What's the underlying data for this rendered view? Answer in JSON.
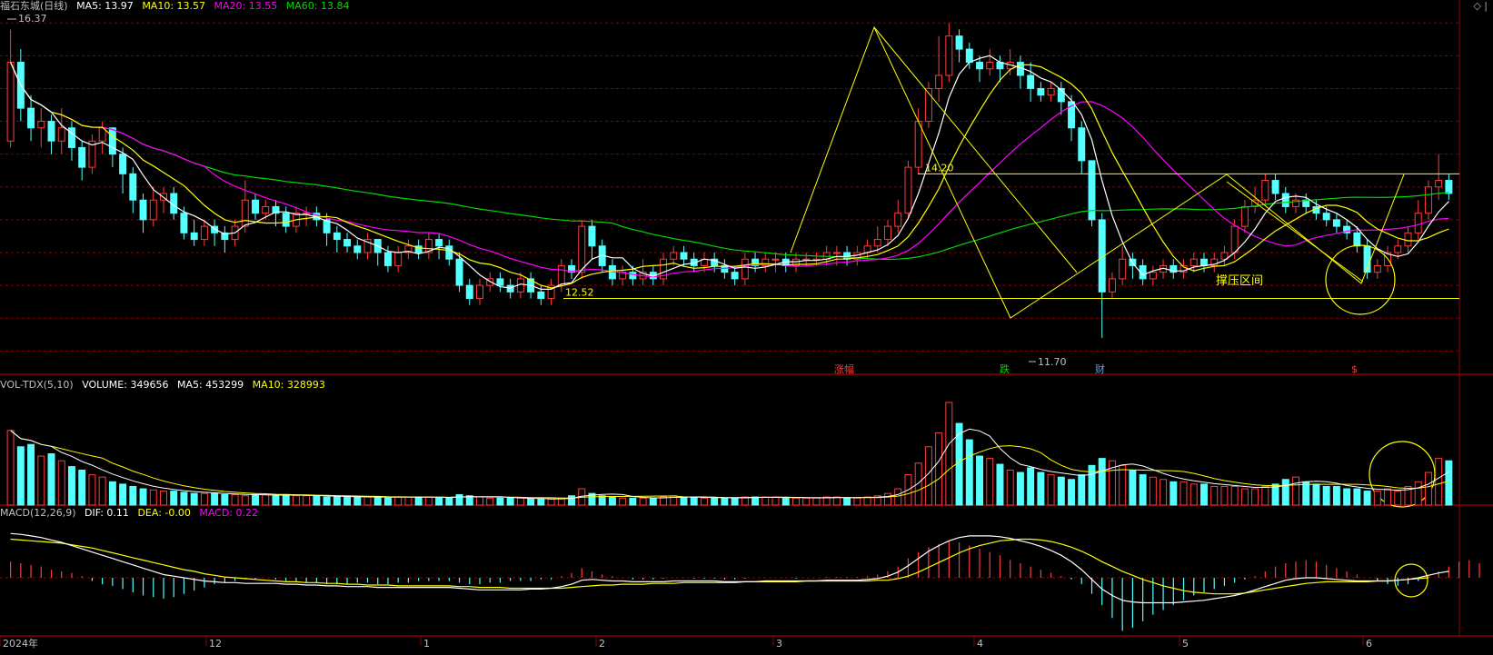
{
  "price_header": {
    "stock": "福石东城(日线)",
    "ma5": "MA5: 13.97",
    "ma10": "MA10: 13.57",
    "ma20": "MA20: 13.55",
    "ma60": "MA60: 13.84"
  },
  "vol_header": {
    "name": "VOL-TDX(5,10)",
    "volume": "VOLUME: 349656",
    "ma5": "MA5: 453299",
    "ma10": "MA10: 328993"
  },
  "macd_header": {
    "name": "MACD(12,26,9)",
    "dif": "DIF: 0.11",
    "dea": "DEA: -0.00",
    "macd": "MACD: 0.22"
  },
  "colors": {
    "up": "#ff3c3c",
    "down": "#54ffff",
    "ma5": "#ffffff",
    "ma10": "#ffff00",
    "ma20": "#ff00ff",
    "ma60": "#00d800",
    "grid": "#8a0000",
    "annot": "#ffff00"
  },
  "chart_data": {
    "type": "candlestick",
    "x_axis_labels": [
      "2024年",
      "12",
      "1",
      "2",
      "3",
      "4",
      "5",
      "6"
    ],
    "price_ylim": [
      11.2,
      16.6
    ],
    "annotations": {
      "high_label": "16.37",
      "low_label": "11.70",
      "level_high": "14.20",
      "level_low": "12.52",
      "zone_text": "撑压区间",
      "events": [
        "涨幅",
        "跌",
        "财",
        "$"
      ]
    },
    "candles": [
      [
        14.7,
        15.9,
        14.6,
        16.4
      ],
      [
        15.9,
        15.2,
        15.0,
        16.1
      ],
      [
        15.2,
        14.9,
        14.7,
        15.4
      ],
      [
        14.9,
        15.0,
        14.6,
        15.2
      ],
      [
        15.0,
        14.7,
        14.5,
        15.1
      ],
      [
        14.7,
        14.9,
        14.5,
        15.2
      ],
      [
        14.9,
        14.6,
        14.4,
        15.0
      ],
      [
        14.6,
        14.3,
        14.1,
        14.7
      ],
      [
        14.3,
        14.7,
        14.2,
        14.8
      ],
      [
        14.7,
        14.9,
        14.5,
        15.0
      ],
      [
        14.9,
        14.5,
        14.3,
        14.9
      ],
      [
        14.5,
        14.2,
        13.9,
        14.6
      ],
      [
        14.2,
        13.8,
        13.6,
        14.3
      ],
      [
        13.8,
        13.5,
        13.3,
        13.9
      ],
      [
        13.5,
        13.8,
        13.4,
        14.0
      ],
      [
        13.8,
        13.9,
        13.6,
        14.0
      ],
      [
        13.9,
        13.6,
        13.5,
        14.0
      ],
      [
        13.6,
        13.3,
        13.2,
        13.7
      ],
      [
        13.3,
        13.2,
        13.1,
        13.5
      ],
      [
        13.2,
        13.4,
        13.1,
        13.5
      ],
      [
        13.4,
        13.3,
        13.1,
        13.5
      ],
      [
        13.3,
        13.2,
        13.0,
        13.4
      ],
      [
        13.2,
        13.4,
        13.1,
        13.5
      ],
      [
        13.4,
        13.8,
        13.3,
        14.1
      ],
      [
        13.8,
        13.6,
        13.5,
        13.9
      ],
      [
        13.6,
        13.7,
        13.5,
        13.8
      ],
      [
        13.7,
        13.6,
        13.4,
        13.8
      ],
      [
        13.6,
        13.4,
        13.3,
        13.7
      ],
      [
        13.4,
        13.6,
        13.3,
        13.7
      ],
      [
        13.6,
        13.6,
        13.4,
        13.7
      ],
      [
        13.6,
        13.5,
        13.4,
        13.7
      ],
      [
        13.5,
        13.3,
        13.1,
        13.6
      ],
      [
        13.3,
        13.2,
        13.0,
        13.4
      ],
      [
        13.2,
        13.1,
        13.0,
        13.3
      ],
      [
        13.1,
        13.0,
        12.9,
        13.2
      ],
      [
        13.0,
        13.2,
        12.9,
        13.3
      ],
      [
        13.2,
        13.0,
        12.8,
        13.2
      ],
      [
        13.0,
        12.8,
        12.7,
        13.1
      ],
      [
        12.8,
        13.0,
        12.7,
        13.1
      ],
      [
        13.0,
        13.1,
        12.9,
        13.2
      ],
      [
        13.1,
        13.0,
        12.9,
        13.2
      ],
      [
        13.0,
        13.2,
        12.9,
        13.3
      ],
      [
        13.2,
        13.1,
        12.9,
        13.3
      ],
      [
        13.1,
        12.9,
        12.8,
        13.2
      ],
      [
        12.9,
        12.5,
        12.4,
        13.0
      ],
      [
        12.5,
        12.3,
        12.2,
        12.6
      ],
      [
        12.3,
        12.5,
        12.2,
        12.6
      ],
      [
        12.5,
        12.6,
        12.4,
        12.7
      ],
      [
        12.6,
        12.5,
        12.4,
        12.7
      ],
      [
        12.5,
        12.4,
        12.3,
        12.6
      ],
      [
        12.4,
        12.6,
        12.3,
        12.7
      ],
      [
        12.6,
        12.4,
        12.3,
        12.7
      ],
      [
        12.4,
        12.3,
        12.2,
        12.5
      ],
      [
        12.3,
        12.5,
        12.2,
        12.6
      ],
      [
        12.5,
        12.8,
        12.4,
        12.9
      ],
      [
        12.8,
        12.7,
        12.6,
        12.9
      ],
      [
        12.7,
        13.4,
        12.6,
        13.5
      ],
      [
        13.4,
        13.1,
        12.9,
        13.5
      ],
      [
        13.1,
        12.8,
        12.7,
        13.2
      ],
      [
        12.8,
        12.6,
        12.5,
        12.9
      ],
      [
        12.6,
        12.7,
        12.5,
        12.8
      ],
      [
        12.7,
        12.6,
        12.5,
        12.8
      ],
      [
        12.6,
        12.7,
        12.5,
        12.9
      ],
      [
        12.7,
        12.6,
        12.5,
        12.8
      ],
      [
        12.6,
        12.9,
        12.5,
        13.0
      ],
      [
        12.9,
        13.0,
        12.8,
        13.1
      ],
      [
        13.0,
        12.9,
        12.8,
        13.1
      ],
      [
        12.9,
        12.8,
        12.7,
        13.0
      ],
      [
        12.8,
        12.9,
        12.7,
        13.0
      ],
      [
        12.9,
        12.8,
        12.7,
        13.0
      ],
      [
        12.8,
        12.7,
        12.6,
        12.9
      ],
      [
        12.7,
        12.6,
        12.5,
        12.8
      ],
      [
        12.6,
        12.9,
        12.5,
        13.0
      ],
      [
        12.9,
        12.8,
        12.7,
        13.0
      ],
      [
        12.8,
        12.9,
        12.7,
        13.0
      ],
      [
        12.9,
        12.9,
        12.7,
        13.0
      ],
      [
        12.9,
        12.8,
        12.7,
        13.0
      ],
      [
        12.8,
        12.9,
        12.7,
        13.0
      ],
      [
        12.9,
        12.9,
        12.8,
        13.0
      ],
      [
        12.9,
        12.9,
        12.8,
        13.0
      ],
      [
        12.9,
        13.0,
        12.8,
        13.1
      ],
      [
        13.0,
        13.0,
        12.8,
        13.1
      ],
      [
        13.0,
        12.9,
        12.8,
        13.1
      ],
      [
        12.9,
        13.0,
        12.8,
        13.1
      ],
      [
        13.0,
        13.1,
        12.9,
        13.2
      ],
      [
        13.1,
        13.2,
        13.0,
        13.4
      ],
      [
        13.2,
        13.4,
        13.1,
        13.5
      ],
      [
        13.4,
        13.6,
        13.3,
        13.8
      ],
      [
        13.6,
        14.3,
        13.5,
        14.4
      ],
      [
        14.3,
        15.0,
        14.2,
        15.2
      ],
      [
        15.0,
        15.5,
        14.9,
        15.6
      ],
      [
        15.5,
        15.7,
        15.3,
        16.3
      ],
      [
        15.7,
        16.3,
        15.6,
        16.5
      ],
      [
        16.3,
        16.1,
        15.9,
        16.4
      ],
      [
        16.1,
        15.9,
        15.8,
        16.2
      ],
      [
        15.9,
        15.8,
        15.6,
        16.0
      ],
      [
        15.8,
        15.9,
        15.7,
        16.1
      ],
      [
        15.9,
        15.8,
        15.6,
        16.0
      ],
      [
        15.8,
        15.9,
        15.7,
        16.1
      ],
      [
        15.9,
        15.7,
        15.5,
        16.0
      ],
      [
        15.7,
        15.5,
        15.3,
        15.9
      ],
      [
        15.5,
        15.4,
        15.3,
        15.6
      ],
      [
        15.4,
        15.5,
        15.3,
        15.6
      ],
      [
        15.5,
        15.3,
        15.1,
        15.6
      ],
      [
        15.3,
        14.9,
        14.7,
        15.4
      ],
      [
        14.9,
        14.4,
        14.2,
        15.0
      ],
      [
        14.4,
        13.5,
        13.4,
        14.4
      ],
      [
        13.5,
        12.4,
        11.7,
        13.6
      ],
      [
        12.4,
        12.6,
        12.3,
        12.7
      ],
      [
        12.6,
        12.9,
        12.5,
        13.1
      ],
      [
        12.9,
        12.8,
        12.6,
        13.0
      ],
      [
        12.8,
        12.6,
        12.5,
        12.9
      ],
      [
        12.6,
        12.7,
        12.5,
        12.8
      ],
      [
        12.7,
        12.8,
        12.6,
        12.9
      ],
      [
        12.8,
        12.7,
        12.6,
        12.9
      ],
      [
        12.7,
        12.8,
        12.6,
        12.9
      ],
      [
        12.8,
        12.9,
        12.7,
        13.0
      ],
      [
        12.9,
        12.8,
        12.7,
        13.0
      ],
      [
        12.8,
        12.9,
        12.7,
        13.0
      ],
      [
        12.9,
        13.0,
        12.8,
        13.1
      ],
      [
        13.0,
        13.4,
        12.9,
        13.5
      ],
      [
        13.4,
        13.7,
        13.3,
        13.8
      ],
      [
        13.7,
        13.8,
        13.6,
        14.0
      ],
      [
        13.8,
        14.1,
        13.7,
        14.2
      ],
      [
        14.1,
        13.9,
        13.8,
        14.2
      ],
      [
        13.9,
        13.7,
        13.6,
        14.0
      ],
      [
        13.7,
        13.8,
        13.6,
        13.9
      ],
      [
        13.8,
        13.7,
        13.6,
        13.9
      ],
      [
        13.7,
        13.6,
        13.5,
        13.8
      ],
      [
        13.6,
        13.5,
        13.4,
        13.7
      ],
      [
        13.5,
        13.4,
        13.3,
        13.6
      ],
      [
        13.4,
        13.3,
        13.2,
        13.5
      ],
      [
        13.3,
        13.1,
        13.0,
        13.4
      ],
      [
        13.1,
        12.7,
        12.6,
        13.2
      ],
      [
        12.7,
        12.8,
        12.6,
        12.9
      ],
      [
        12.8,
        13.0,
        12.7,
        13.1
      ],
      [
        13.0,
        13.1,
        12.9,
        13.2
      ],
      [
        13.1,
        13.3,
        13.0,
        13.4
      ],
      [
        13.3,
        13.6,
        13.2,
        13.8
      ],
      [
        13.6,
        14.0,
        13.5,
        14.1
      ],
      [
        14.0,
        14.1,
        13.8,
        14.5
      ],
      [
        14.1,
        13.9,
        13.8,
        14.2
      ]
    ],
    "volume": [
      64,
      50,
      52,
      42,
      44,
      38,
      33,
      30,
      26,
      24,
      20,
      18,
      16,
      14,
      13,
      12,
      12,
      11,
      10,
      10,
      10,
      9,
      9,
      8,
      9,
      9,
      8,
      9,
      8,
      8,
      8,
      7,
      7,
      7,
      7,
      7,
      7,
      6,
      7,
      7,
      7,
      7,
      6,
      6,
      9,
      8,
      7,
      6,
      6,
      6,
      6,
      5,
      5,
      5,
      6,
      8,
      14,
      10,
      8,
      7,
      6,
      6,
      6,
      6,
      7,
      8,
      7,
      7,
      6,
      6,
      6,
      6,
      7,
      7,
      7,
      7,
      6,
      6,
      6,
      6,
      7,
      7,
      6,
      6,
      7,
      8,
      10,
      14,
      26,
      36,
      50,
      62,
      88,
      70,
      56,
      42,
      40,
      35,
      30,
      28,
      32,
      28,
      26,
      24,
      22,
      26,
      34,
      40,
      38,
      34,
      30,
      26,
      24,
      22,
      20,
      20,
      18,
      18,
      16,
      16,
      16,
      14,
      14,
      16,
      18,
      22,
      24,
      20,
      18,
      16,
      16,
      14,
      14,
      12,
      12,
      14,
      12,
      16,
      20,
      28,
      40,
      38
    ],
    "vol_ylim": [
      0,
      95
    ],
    "macd": [
      20,
      18,
      16,
      14,
      10,
      8,
      6,
      2,
      -4,
      -8,
      -10,
      -14,
      -18,
      -22,
      -24,
      -26,
      -24,
      -20,
      -16,
      -12,
      -8,
      -6,
      -4,
      -2,
      -2,
      0,
      -2,
      -4,
      -4,
      -6,
      -6,
      -8,
      -8,
      -8,
      -6,
      -6,
      -8,
      -8,
      -6,
      -6,
      -4,
      -4,
      -4,
      -4,
      -6,
      -8,
      -8,
      -6,
      -6,
      -4,
      -4,
      -4,
      -2,
      -2,
      2,
      6,
      12,
      8,
      4,
      2,
      0,
      -2,
      -2,
      -2,
      -1,
      0,
      0,
      -1,
      -1,
      -1,
      -2,
      -2,
      -1,
      0,
      0,
      0,
      0,
      -1,
      0,
      0,
      1,
      1,
      1,
      1,
      2,
      4,
      8,
      14,
      24,
      32,
      38,
      42,
      46,
      44,
      40,
      36,
      32,
      28,
      22,
      18,
      14,
      10,
      6,
      2,
      -2,
      -8,
      -20,
      -34,
      -50,
      -66,
      -62,
      -54,
      -46,
      -40,
      -34,
      -28,
      -22,
      -18,
      -14,
      -10,
      -6,
      -2,
      2,
      8,
      14,
      18,
      20,
      22,
      20,
      16,
      12,
      8,
      4,
      0,
      -4,
      -8,
      -10,
      -8,
      -4,
      2,
      8,
      14,
      20,
      22,
      18
    ],
    "dif": [
      55,
      54,
      52,
      50,
      47,
      44,
      40,
      36,
      32,
      28,
      24,
      20,
      16,
      12,
      8,
      4,
      2,
      0,
      -2,
      -4,
      -5,
      -6,
      -6,
      -7,
      -7,
      -7,
      -7,
      -8,
      -8,
      -9,
      -9,
      -10,
      -10,
      -11,
      -11,
      -11,
      -12,
      -12,
      -12,
      -12,
      -12,
      -12,
      -12,
      -12,
      -13,
      -14,
      -15,
      -15,
      -15,
      -15,
      -15,
      -14,
      -14,
      -13,
      -11,
      -8,
      -3,
      -2,
      -3,
      -4,
      -4,
      -5,
      -5,
      -5,
      -5,
      -4,
      -4,
      -4,
      -4,
      -4,
      -5,
      -5,
      -5,
      -5,
      -4,
      -4,
      -4,
      -4,
      -4,
      -4,
      -3,
      -3,
      -3,
      -3,
      -2,
      -1,
      2,
      7,
      15,
      24,
      33,
      40,
      46,
      50,
      52,
      52,
      52,
      51,
      49,
      46,
      43,
      39,
      34,
      28,
      20,
      10,
      -2,
      -14,
      -22,
      -28,
      -30,
      -31,
      -31,
      -31,
      -31,
      -30,
      -29,
      -28,
      -26,
      -24,
      -22,
      -19,
      -15,
      -11,
      -7,
      -3,
      -1,
      0,
      0,
      -1,
      -2,
      -3,
      -4,
      -4,
      -4,
      -4,
      -3,
      -2,
      0,
      3,
      6,
      8
    ],
    "dea": [
      48,
      47,
      46,
      45,
      44,
      43,
      41,
      39,
      37,
      34,
      31,
      28,
      25,
      22,
      19,
      16,
      13,
      10,
      8,
      5,
      3,
      1,
      0,
      -1,
      -2,
      -3,
      -4,
      -5,
      -5,
      -6,
      -6,
      -7,
      -7,
      -8,
      -8,
      -9,
      -9,
      -9,
      -10,
      -10,
      -10,
      -10,
      -10,
      -10,
      -11,
      -11,
      -12,
      -12,
      -12,
      -13,
      -13,
      -13,
      -13,
      -13,
      -13,
      -12,
      -11,
      -10,
      -9,
      -9,
      -8,
      -8,
      -8,
      -7,
      -7,
      -7,
      -6,
      -6,
      -6,
      -6,
      -6,
      -6,
      -5,
      -5,
      -5,
      -5,
      -5,
      -5,
      -4,
      -4,
      -4,
      -4,
      -4,
      -4,
      -4,
      -3,
      -3,
      -1,
      2,
      7,
      13,
      19,
      25,
      31,
      36,
      40,
      43,
      46,
      47,
      48,
      48,
      47,
      45,
      42,
      38,
      33,
      27,
      20,
      14,
      8,
      3,
      -2,
      -6,
      -10,
      -13,
      -16,
      -18,
      -19,
      -20,
      -20,
      -20,
      -19,
      -17,
      -15,
      -13,
      -11,
      -9,
      -7,
      -6,
      -5,
      -5,
      -5,
      -5,
      -5,
      -4,
      -4,
      -3,
      -2,
      -1,
      0
    ],
    "macd_ylim": [
      -70,
      70
    ]
  },
  "controls": {
    "expand": "◇",
    "collapse": "|"
  }
}
